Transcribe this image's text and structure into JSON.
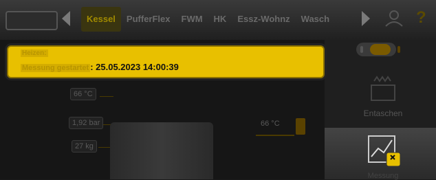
{
  "header": {
    "tabs": [
      {
        "label": "Kessel",
        "active": true
      },
      {
        "label": "PufferFlex",
        "active": false
      },
      {
        "label": "FWM",
        "active": false
      },
      {
        "label": "HK",
        "active": false
      },
      {
        "label": "Essz-Wohnz",
        "active": false
      },
      {
        "label": "Wasch",
        "active": false
      }
    ],
    "help": "?"
  },
  "tooltip": {
    "line1": "Heizen:",
    "label": "Messung gestartet",
    "datetime": ": 25.05.2023 14:00:39"
  },
  "panel": {
    "temp1": "66 °C",
    "pressure": "1,92 bar",
    "weight": "27 kg",
    "temp2": "66 °C"
  },
  "sidebar": {
    "entaschen": "Entaschen",
    "messung": "Messung"
  },
  "colors": {
    "accent": "#e8c000",
    "background": "#1a1a1a"
  }
}
